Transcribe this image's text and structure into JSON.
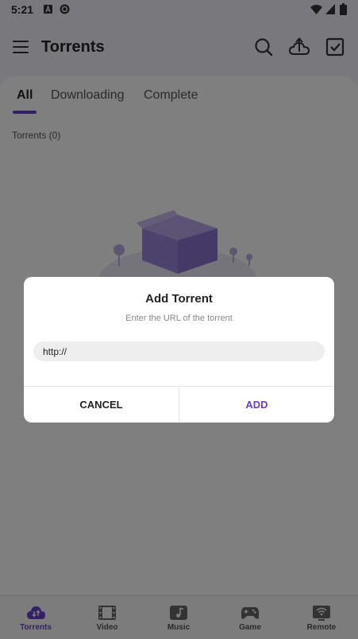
{
  "status_bar": {
    "time": "5:21"
  },
  "app_bar": {
    "title": "Torrents"
  },
  "tabs": [
    {
      "label": "All"
    },
    {
      "label": "Downloading"
    },
    {
      "label": "Complete"
    }
  ],
  "list": {
    "count_label": "Torrents (0)"
  },
  "bottom_nav": [
    {
      "label": "Torrents",
      "icon": "cloud-download-icon"
    },
    {
      "label": "Video",
      "icon": "film-icon"
    },
    {
      "label": "Music",
      "icon": "music-icon"
    },
    {
      "label": "Game",
      "icon": "gamepad-icon"
    },
    {
      "label": "Remote",
      "icon": "remote-wifi-icon"
    }
  ],
  "dialog": {
    "title": "Add Torrent",
    "subtitle": "Enter the URL of the torrent",
    "url_value": "http://",
    "cancel_label": "CANCEL",
    "add_label": "ADD"
  },
  "colors": {
    "accent": "#6b3fc8",
    "background": "#f3f1f8",
    "scrim": "rgba(0,0,0,0.5)"
  }
}
